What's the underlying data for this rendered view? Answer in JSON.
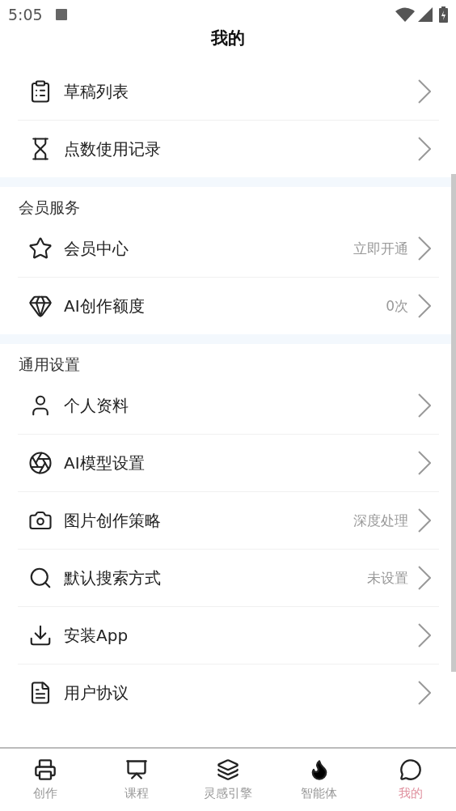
{
  "status_bar": {
    "time": "5:05"
  },
  "header": {
    "title": "我的"
  },
  "sections": [
    {
      "items": [
        {
          "label": "草稿列表"
        },
        {
          "label": "点数使用记录"
        }
      ]
    },
    {
      "title": "会员服务",
      "items": [
        {
          "label": "会员中心",
          "value": "立即开通"
        },
        {
          "label": "AI创作额度",
          "value": "0次"
        }
      ]
    },
    {
      "title": "通用设置",
      "items": [
        {
          "label": "个人资料"
        },
        {
          "label": "AI模型设置"
        },
        {
          "label": "图片创作策略",
          "value": "深度处理"
        },
        {
          "label": "默认搜索方式",
          "value": "未设置"
        },
        {
          "label": "安装App"
        },
        {
          "label": "用户协议"
        }
      ]
    }
  ],
  "bottom_nav": [
    {
      "label": "创作",
      "selected": false
    },
    {
      "label": "课程",
      "selected": false
    },
    {
      "label": "灵感引擎",
      "selected": false
    },
    {
      "label": "智能体",
      "selected": false
    },
    {
      "label": "我的",
      "selected": true
    }
  ]
}
